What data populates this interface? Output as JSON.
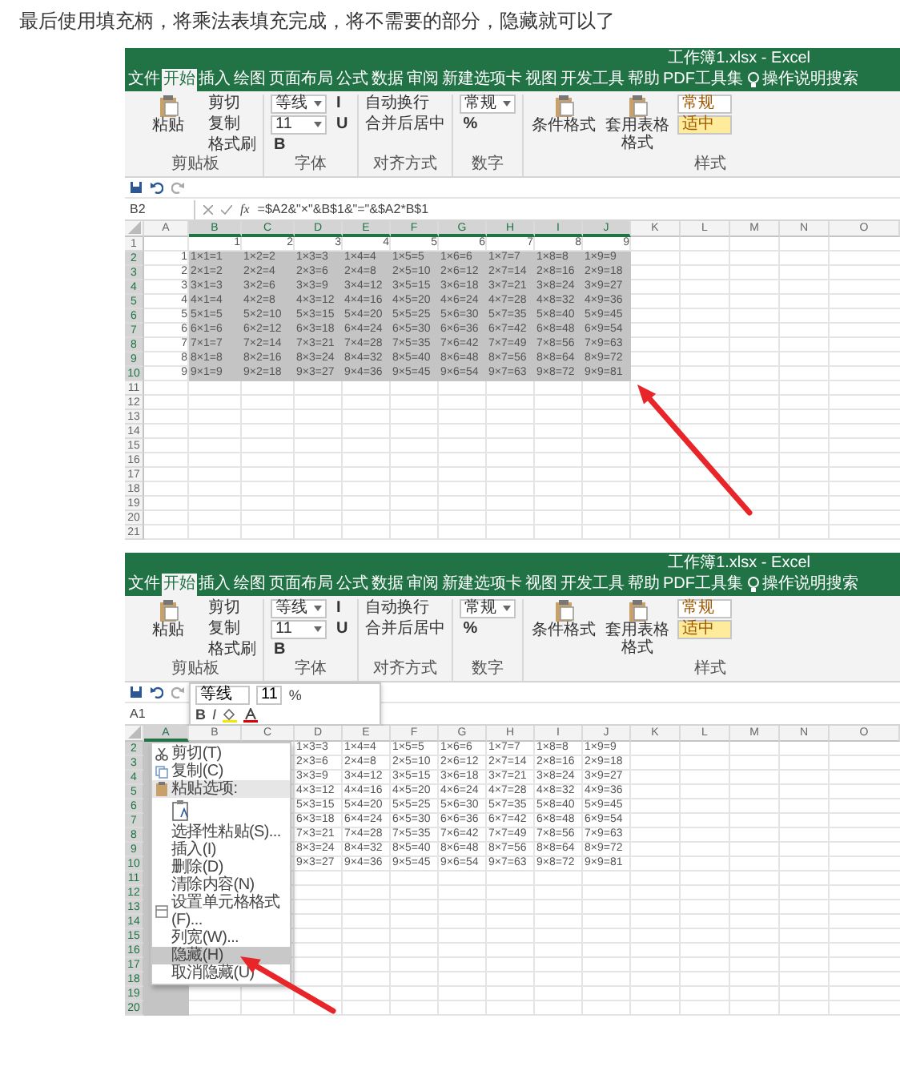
{
  "intro": "最后使用填充柄，将乘法表填充完成，将不需要的部分，隐藏就可以了",
  "screenshots": [
    {
      "kind": "fill",
      "title": "工作簿1.xlsx  -  Excel",
      "tabs": [
        {
          "label": "文件",
          "selected": false
        },
        {
          "label": "开始",
          "selected": true
        },
        {
          "label": "插入",
          "selected": false
        },
        {
          "label": "绘图",
          "selected": false
        },
        {
          "label": "页面布局",
          "selected": false
        },
        {
          "label": "公式",
          "selected": false
        },
        {
          "label": "数据",
          "selected": false
        },
        {
          "label": "审阅",
          "selected": false
        },
        {
          "label": "新建选项卡",
          "selected": false
        },
        {
          "label": "视图",
          "selected": false
        },
        {
          "label": "开发工具",
          "selected": false
        },
        {
          "label": "帮助",
          "selected": false
        },
        {
          "label": "PDF工具集",
          "selected": false
        }
      ],
      "search": "操作说明搜索",
      "ribbon": [
        {
          "label": "剪贴板",
          "items": [
            {
              "kind": "big",
              "text": "粘贴"
            },
            {
              "kind": "small",
              "text": "剪切"
            },
            {
              "kind": "small",
              "text": "复制"
            },
            {
              "kind": "small",
              "text": "格式刷"
            }
          ]
        },
        {
          "label": "字体",
          "items": [
            {
              "kind": "field",
              "text": "等线"
            },
            {
              "kind": "field",
              "text": "11"
            },
            {
              "kind": "button",
              "text": "B"
            },
            {
              "kind": "button",
              "text": "I"
            },
            {
              "kind": "button",
              "text": "U"
            }
          ]
        },
        {
          "label": "对齐方式",
          "items": [
            {
              "kind": "small",
              "text": "自动换行"
            },
            {
              "kind": "small",
              "text": "合并后居中"
            }
          ]
        },
        {
          "label": "数字",
          "items": [
            {
              "kind": "field",
              "text": "常规"
            },
            {
              "kind": "button",
              "text": "%"
            }
          ]
        },
        {
          "label": "样式",
          "items": [
            {
              "kind": "big",
              "text": "条件格式"
            },
            {
              "kind": "big",
              "text": "套用表格格式"
            },
            {
              "kind": "style",
              "text": "常规",
              "color": "#ffffff"
            },
            {
              "kind": "style",
              "text": "适中",
              "color": "#ffeb9c"
            }
          ]
        }
      ],
      "formula_bar": {
        "name_box": "B2",
        "fx": "fx",
        "formula": "=$A2&\"×\"&B$1&\"=\"&$A2*B$1"
      },
      "columns": [
        {
          "label": "A",
          "selected": false
        },
        {
          "label": "B",
          "selected": true
        },
        {
          "label": "C",
          "selected": true
        },
        {
          "label": "D",
          "selected": true
        },
        {
          "label": "E",
          "selected": true
        },
        {
          "label": "F",
          "selected": true
        },
        {
          "label": "G",
          "selected": true
        },
        {
          "label": "H",
          "selected": true
        },
        {
          "label": "I",
          "selected": true
        },
        {
          "label": "J",
          "selected": true
        },
        {
          "label": "K",
          "selected": false
        },
        {
          "label": "L",
          "selected": false
        },
        {
          "label": "M",
          "selected": false
        },
        {
          "label": "N",
          "selected": false
        },
        {
          "label": "O",
          "selected": false
        }
      ],
      "rows": [
        {
          "number": "1",
          "selected": false,
          "kind": "numbers",
          "cells": [
            "1",
            "2",
            "3",
            "4",
            "5",
            "6",
            "7",
            "8",
            "9"
          ]
        },
        {
          "number": "2",
          "selected": true,
          "kind": "formulas",
          "label_cell": "1",
          "cells": [
            "1×1=1",
            "1×2=2",
            "1×3=3",
            "1×4=4",
            "1×5=5",
            "1×6=6",
            "1×7=7",
            "1×8=8",
            "1×9=9"
          ]
        },
        {
          "number": "3",
          "selected": true,
          "kind": "formulas",
          "label_cell": "2",
          "cells": [
            "2×1=2",
            "2×2=4",
            "2×3=6",
            "2×4=8",
            "2×5=10",
            "2×6=12",
            "2×7=14",
            "2×8=16",
            "2×9=18"
          ]
        },
        {
          "number": "4",
          "selected": true,
          "kind": "formulas",
          "label_cell": "3",
          "cells": [
            "3×1=3",
            "3×2=6",
            "3×3=9",
            "3×4=12",
            "3×5=15",
            "3×6=18",
            "3×7=21",
            "3×8=24",
            "3×9=27"
          ]
        },
        {
          "number": "5",
          "selected": true,
          "kind": "formulas",
          "label_cell": "4",
          "cells": [
            "4×1=4",
            "4×2=8",
            "4×3=12",
            "4×4=16",
            "4×5=20",
            "4×6=24",
            "4×7=28",
            "4×8=32",
            "4×9=36"
          ]
        },
        {
          "number": "6",
          "selected": true,
          "kind": "formulas",
          "label_cell": "5",
          "cells": [
            "5×1=5",
            "5×2=10",
            "5×3=15",
            "5×4=20",
            "5×5=25",
            "5×6=30",
            "5×7=35",
            "5×8=40",
            "5×9=45"
          ]
        },
        {
          "number": "7",
          "selected": true,
          "kind": "formulas",
          "label_cell": "6",
          "cells": [
            "6×1=6",
            "6×2=12",
            "6×3=18",
            "6×4=24",
            "6×5=30",
            "6×6=36",
            "6×7=42",
            "6×8=48",
            "6×9=54"
          ]
        },
        {
          "number": "8",
          "selected": true,
          "kind": "formulas",
          "label_cell": "7",
          "cells": [
            "7×1=7",
            "7×2=14",
            "7×3=21",
            "7×4=28",
            "7×5=35",
            "7×6=42",
            "7×7=49",
            "7×8=56",
            "7×9=63"
          ]
        },
        {
          "number": "9",
          "selected": true,
          "kind": "formulas",
          "label_cell": "8",
          "cells": [
            "8×1=8",
            "8×2=16",
            "8×3=24",
            "8×4=32",
            "8×5=40",
            "8×6=48",
            "8×7=56",
            "8×8=64",
            "8×9=72"
          ]
        },
        {
          "number": "10",
          "selected": true,
          "kind": "formulas",
          "label_cell": "9",
          "cells": [
            "9×1=9",
            "9×2=18",
            "9×3=27",
            "9×4=36",
            "9×5=45",
            "9×6=54",
            "9×7=63",
            "9×8=72",
            "9×9=81"
          ]
        },
        {
          "number": "11",
          "selected": false,
          "kind": "blank"
        },
        {
          "number": "12",
          "selected": false,
          "kind": "blank"
        },
        {
          "number": "13",
          "selected": false,
          "kind": "blank"
        },
        {
          "number": "14",
          "selected": false,
          "kind": "blank"
        },
        {
          "number": "15",
          "selected": false,
          "kind": "blank"
        },
        {
          "number": "16",
          "selected": false,
          "kind": "blank"
        },
        {
          "number": "17",
          "selected": false,
          "kind": "blank"
        },
        {
          "number": "18",
          "selected": false,
          "kind": "blank"
        },
        {
          "number": "19",
          "selected": false,
          "kind": "blank"
        },
        {
          "number": "20",
          "selected": false,
          "kind": "blank"
        },
        {
          "number": "21",
          "selected": false,
          "kind": "blank"
        }
      ]
    },
    {
      "kind": "hide",
      "title": "工作簿1.xlsx  -  Excel",
      "tabs": [
        {
          "label": "文件",
          "selected": false
        },
        {
          "label": "开始",
          "selected": true
        },
        {
          "label": "插入",
          "selected": false
        },
        {
          "label": "绘图",
          "selected": false
        },
        {
          "label": "页面布局",
          "selected": false
        },
        {
          "label": "公式",
          "selected": false
        },
        {
          "label": "数据",
          "selected": false
        },
        {
          "label": "审阅",
          "selected": false
        },
        {
          "label": "新建选项卡",
          "selected": false
        },
        {
          "label": "视图",
          "selected": false
        },
        {
          "label": "开发工具",
          "selected": false
        },
        {
          "label": "帮助",
          "selected": false
        },
        {
          "label": "PDF工具集",
          "selected": false
        }
      ],
      "search": "操作说明搜索",
      "ribbon": [
        {
          "label": "剪贴板",
          "items": [
            {
              "kind": "big",
              "text": "粘贴"
            },
            {
              "kind": "small",
              "text": "剪切"
            },
            {
              "kind": "small",
              "text": "复制"
            },
            {
              "kind": "small",
              "text": "格式刷"
            }
          ]
        },
        {
          "label": "字体",
          "items": [
            {
              "kind": "field",
              "text": "等线"
            },
            {
              "kind": "field",
              "text": "11"
            },
            {
              "kind": "button",
              "text": "B"
            },
            {
              "kind": "button",
              "text": "I"
            },
            {
              "kind": "button",
              "text": "U"
            }
          ]
        },
        {
          "label": "对齐方式",
          "items": [
            {
              "kind": "small",
              "text": "自动换行"
            },
            {
              "kind": "small",
              "text": "合并后居中"
            }
          ]
        },
        {
          "label": "数字",
          "items": [
            {
              "kind": "field",
              "text": "常规"
            },
            {
              "kind": "button",
              "text": "%"
            }
          ]
        },
        {
          "label": "样式",
          "items": [
            {
              "kind": "big",
              "text": "条件格式"
            },
            {
              "kind": "big",
              "text": "套用表格格式"
            },
            {
              "kind": "style",
              "text": "常规",
              "color": "#ffffff"
            },
            {
              "kind": "style",
              "text": "适中",
              "color": "#ffeb9c"
            }
          ]
        }
      ],
      "formula_bar": {
        "name_box": "A1"
      },
      "mini_toolbar": {
        "font": "等线",
        "size": "11",
        "percent": "%",
        "bold": "B",
        "italic": "I"
      },
      "columns": [
        {
          "label": "A",
          "selected": true
        },
        {
          "label": "B",
          "selected": false
        },
        {
          "label": "C",
          "selected": false
        },
        {
          "label": "D",
          "selected": false
        },
        {
          "label": "E",
          "selected": false
        },
        {
          "label": "F",
          "selected": false
        },
        {
          "label": "G",
          "selected": false
        },
        {
          "label": "H",
          "selected": false
        },
        {
          "label": "I",
          "selected": false
        },
        {
          "label": "J",
          "selected": false
        },
        {
          "label": "K",
          "selected": false
        },
        {
          "label": "L",
          "selected": false
        },
        {
          "label": "M",
          "selected": false
        },
        {
          "label": "N",
          "selected": false
        },
        {
          "label": "O",
          "selected": false
        }
      ],
      "rows": [
        {
          "number": "2",
          "selected": true,
          "kind": "formulas",
          "cells": [
            "1×3=3",
            "1×4=4",
            "1×5=5",
            "1×6=6",
            "1×7=7",
            "1×8=8",
            "1×9=9"
          ]
        },
        {
          "number": "3",
          "selected": true,
          "kind": "formulas",
          "cells": [
            "2×3=6",
            "2×4=8",
            "2×5=10",
            "2×6=12",
            "2×7=14",
            "2×8=16",
            "2×9=18"
          ]
        },
        {
          "number": "4",
          "selected": true,
          "kind": "formulas",
          "cells": [
            "3×3=9",
            "3×4=12",
            "3×5=15",
            "3×6=18",
            "3×7=21",
            "3×8=24",
            "3×9=27"
          ]
        },
        {
          "number": "5",
          "selected": true,
          "kind": "formulas",
          "cells": [
            "4×3=12",
            "4×4=16",
            "4×5=20",
            "4×6=24",
            "4×7=28",
            "4×8=32",
            "4×9=36"
          ]
        },
        {
          "number": "6",
          "selected": true,
          "kind": "formulas",
          "cells": [
            "5×3=15",
            "5×4=20",
            "5×5=25",
            "5×6=30",
            "5×7=35",
            "5×8=40",
            "5×9=45"
          ]
        },
        {
          "number": "7",
          "selected": true,
          "kind": "formulas",
          "cells": [
            "6×3=18",
            "6×4=24",
            "6×5=30",
            "6×6=36",
            "6×7=42",
            "6×8=48",
            "6×9=54"
          ]
        },
        {
          "number": "8",
          "selected": true,
          "kind": "formulas",
          "cells": [
            "7×3=21",
            "7×4=28",
            "7×5=35",
            "7×6=42",
            "7×7=49",
            "7×8=56",
            "7×9=63"
          ]
        },
        {
          "number": "9",
          "selected": true,
          "kind": "formulas",
          "cells": [
            "8×3=24",
            "8×4=32",
            "8×5=40",
            "8×6=48",
            "8×7=56",
            "8×8=64",
            "8×9=72"
          ]
        },
        {
          "number": "10",
          "selected": true,
          "kind": "formulas",
          "cells": [
            "9×3=27",
            "9×4=36",
            "9×5=45",
            "9×6=54",
            "9×7=63",
            "9×8=72",
            "9×9=81"
          ]
        },
        {
          "number": "11",
          "selected": true,
          "kind": "blank"
        },
        {
          "number": "12",
          "selected": true,
          "kind": "blank"
        },
        {
          "number": "13",
          "selected": true,
          "kind": "blank"
        },
        {
          "number": "14",
          "selected": true,
          "kind": "blank"
        },
        {
          "number": "15",
          "selected": true,
          "kind": "blank"
        },
        {
          "number": "16",
          "selected": true,
          "kind": "blank"
        },
        {
          "number": "17",
          "selected": true,
          "kind": "blank"
        },
        {
          "number": "18",
          "selected": true,
          "kind": "blank"
        },
        {
          "number": "19",
          "selected": true,
          "kind": "blank"
        },
        {
          "number": "20",
          "selected": true,
          "kind": "blank"
        }
      ],
      "context_menu": [
        {
          "kind": "cut",
          "label": "剪切(T)",
          "selected": false
        },
        {
          "kind": "copy",
          "label": "复制(C)",
          "selected": false
        },
        {
          "kind": "paste-header",
          "label": "粘贴选项:",
          "selected": false
        },
        {
          "kind": "paste-option",
          "selected": false
        },
        {
          "kind": "item",
          "label": "选择性粘贴(S)...",
          "selected": false
        },
        {
          "kind": "item",
          "label": "插入(I)",
          "selected": false
        },
        {
          "kind": "item",
          "label": "删除(D)",
          "selected": false
        },
        {
          "kind": "item",
          "label": "清除内容(N)",
          "selected": false
        },
        {
          "kind": "format",
          "label": "设置单元格格式(F)...",
          "selected": false
        },
        {
          "kind": "item",
          "label": "列宽(W)...",
          "selected": false
        },
        {
          "kind": "item",
          "label": "隐藏(H)",
          "selected": true
        },
        {
          "kind": "item",
          "label": "取消隐藏(U)",
          "selected": false
        }
      ]
    }
  ]
}
